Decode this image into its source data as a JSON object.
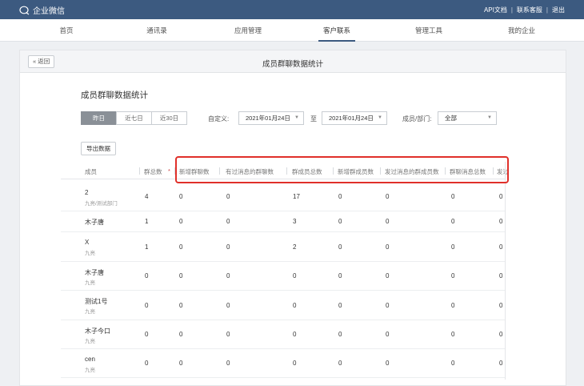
{
  "app": {
    "name": "企业微信"
  },
  "toplinks": [
    "API文档",
    "联系客服",
    "退出"
  ],
  "nav": [
    {
      "label": "首页",
      "active": false
    },
    {
      "label": "通讯录",
      "active": false
    },
    {
      "label": "应用管理",
      "active": false
    },
    {
      "label": "客户联系",
      "active": true
    },
    {
      "label": "管理工具",
      "active": false
    },
    {
      "label": "我的企业",
      "active": false
    }
  ],
  "page": {
    "back_label": "« 返回",
    "header_title": "成员群聊数据统计",
    "section_title": "成员群聊数据统计"
  },
  "filters": {
    "ranges": [
      {
        "label": "昨日",
        "active": true
      },
      {
        "label": "近七日",
        "active": false
      },
      {
        "label": "近30日",
        "active": false
      }
    ],
    "custom_label": "自定义:",
    "start_date": "2021年01月24日",
    "to_label": "至",
    "end_date": "2021年01月24日",
    "member_label": "成员/部门:",
    "member_value": "全部"
  },
  "export_label": "导出数据",
  "table": {
    "columns": [
      "成员",
      "群总数",
      "新增群聊数",
      "有过消息的群聊数",
      "群成员总数",
      "新增群成员数",
      "发过消息的群成员数",
      "群聊消息总数",
      "发过"
    ],
    "sort_marker": "*",
    "rows": [
      {
        "name": "2",
        "dept": "九亮/测试部门",
        "values": [
          "4",
          "0",
          "0",
          "17",
          "0",
          "0",
          "0",
          "0"
        ]
      },
      {
        "name": "木子唐",
        "dept": "",
        "values": [
          "1",
          "0",
          "0",
          "3",
          "0",
          "0",
          "0",
          "0"
        ]
      },
      {
        "name": "X",
        "dept": "九亮",
        "values": [
          "1",
          "0",
          "0",
          "2",
          "0",
          "0",
          "0",
          "0"
        ]
      },
      {
        "name": "木子唐",
        "dept": "九亮",
        "values": [
          "0",
          "0",
          "0",
          "0",
          "0",
          "0",
          "0",
          "0"
        ]
      },
      {
        "name": "测试1号",
        "dept": "九亮",
        "values": [
          "0",
          "0",
          "0",
          "0",
          "0",
          "0",
          "0",
          "0"
        ]
      },
      {
        "name": "木子今口",
        "dept": "九亮",
        "values": [
          "0",
          "0",
          "0",
          "0",
          "0",
          "0",
          "0",
          "0"
        ]
      },
      {
        "name": "cen",
        "dept": "九亮",
        "values": [
          "0",
          "0",
          "0",
          "0",
          "0",
          "0",
          "0",
          "0"
        ]
      }
    ]
  },
  "colors": {
    "topbar": "#3c5a80",
    "highlight": "#e0302a",
    "active_range": "#8a9097"
  }
}
